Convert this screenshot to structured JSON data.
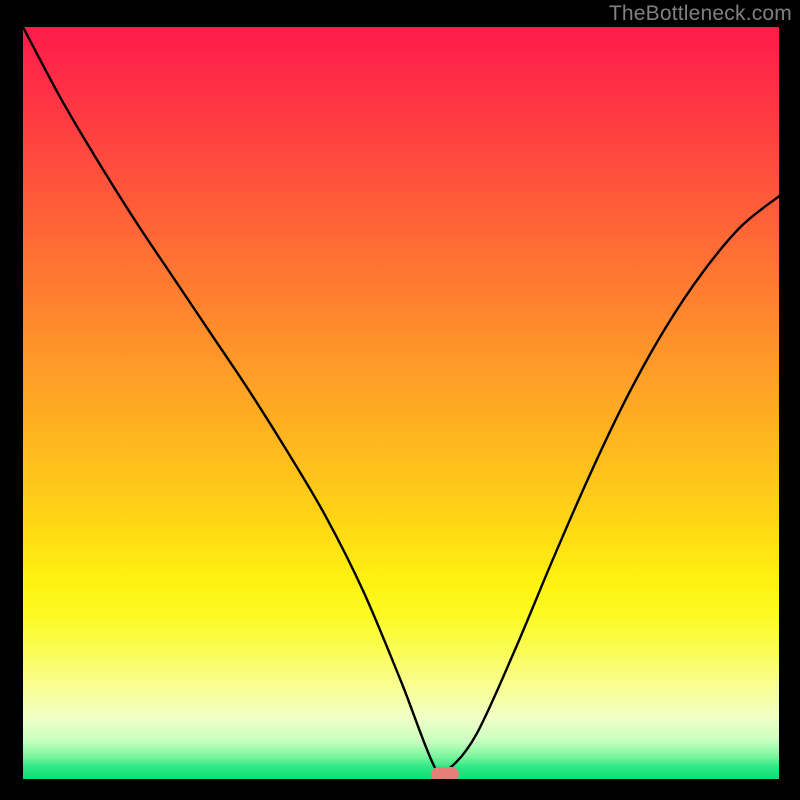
{
  "watermark": {
    "text": "TheBottleneck.com"
  },
  "chart_data": {
    "type": "line",
    "title": "",
    "xlabel": "",
    "ylabel": "",
    "x": [
      0.0,
      0.05,
      0.1,
      0.15,
      0.2,
      0.25,
      0.3,
      0.35,
      0.4,
      0.45,
      0.5,
      0.545,
      0.565,
      0.6,
      0.65,
      0.7,
      0.75,
      0.8,
      0.85,
      0.9,
      0.95,
      1.0
    ],
    "values": [
      1.0,
      0.905,
      0.82,
      0.74,
      0.665,
      0.59,
      0.515,
      0.435,
      0.35,
      0.25,
      0.13,
      0.015,
      0.015,
      0.06,
      0.17,
      0.29,
      0.405,
      0.51,
      0.6,
      0.675,
      0.735,
      0.775
    ],
    "ylim": [
      0,
      1
    ],
    "xlim": [
      0,
      1
    ],
    "marker": {
      "x": 0.558,
      "y": 0.0
    },
    "gradient_stops": [
      {
        "pos": 0.0,
        "color": "#ff1a4a"
      },
      {
        "pos": 0.25,
        "color": "#ff6038"
      },
      {
        "pos": 0.55,
        "color": "#ffb61f"
      },
      {
        "pos": 0.75,
        "color": "#fff00f"
      },
      {
        "pos": 0.92,
        "color": "#f0ffc6"
      },
      {
        "pos": 1.0,
        "color": "#0ede79"
      }
    ]
  }
}
